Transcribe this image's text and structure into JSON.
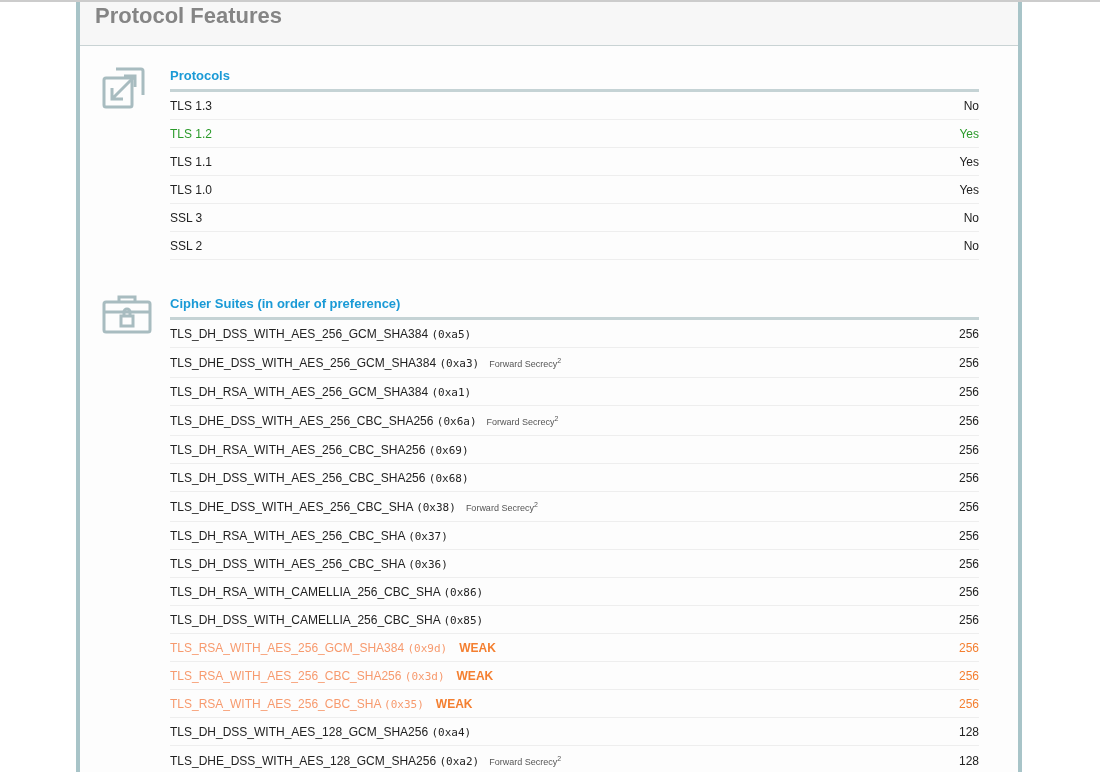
{
  "title": "Protocol Features",
  "protocols": {
    "heading": "Protocols",
    "rows": [
      {
        "name": "TLS 1.3",
        "value": "No",
        "kind": "plain"
      },
      {
        "name": "TLS 1.2",
        "value": "Yes",
        "kind": "good"
      },
      {
        "name": "TLS 1.1",
        "value": "Yes",
        "kind": "plain"
      },
      {
        "name": "TLS 1.0",
        "value": "Yes",
        "kind": "plain"
      },
      {
        "name": "SSL 3",
        "value": "No",
        "kind": "plain"
      },
      {
        "name": "SSL 2",
        "value": "No",
        "kind": "plain"
      }
    ]
  },
  "cipher_suites": {
    "heading": "Cipher Suites (in order of preference)",
    "rows": [
      {
        "name": "TLS_DH_DSS_WITH_AES_256_GCM_SHA384",
        "code": "(0xa5)",
        "bits": "256",
        "kind": "plain"
      },
      {
        "name": "TLS_DHE_DSS_WITH_AES_256_GCM_SHA384",
        "code": "(0xa3)",
        "note": "Forward Secrecy$^{2}$",
        "bits": "256",
        "kind": "plain"
      },
      {
        "name": "TLS_DH_RSA_WITH_AES_256_GCM_SHA384",
        "code": "(0xa1)",
        "bits": "256",
        "kind": "plain"
      },
      {
        "name": "TLS_DHE_DSS_WITH_AES_256_CBC_SHA256",
        "code": "(0x6a)",
        "note": "Forward Secrecy$^{2}$",
        "bits": "256",
        "kind": "plain"
      },
      {
        "name": "TLS_DH_RSA_WITH_AES_256_CBC_SHA256",
        "code": "(0x69)",
        "bits": "256",
        "kind": "plain"
      },
      {
        "name": "TLS_DH_DSS_WITH_AES_256_CBC_SHA256",
        "code": "(0x68)",
        "bits": "256",
        "kind": "plain"
      },
      {
        "name": "TLS_DHE_DSS_WITH_AES_256_CBC_SHA",
        "code": "(0x38)",
        "note": "Forward Secrecy$^{2}$",
        "bits": "256",
        "kind": "plain"
      },
      {
        "name": "TLS_DH_RSA_WITH_AES_256_CBC_SHA",
        "code": "(0x37)",
        "bits": "256",
        "kind": "plain"
      },
      {
        "name": "TLS_DH_DSS_WITH_AES_256_CBC_SHA",
        "code": "(0x36)",
        "bits": "256",
        "kind": "plain"
      },
      {
        "name": "TLS_DH_RSA_WITH_CAMELLIA_256_CBC_SHA",
        "code": "(0x86)",
        "bits": "256",
        "kind": "plain"
      },
      {
        "name": "TLS_DH_DSS_WITH_CAMELLIA_256_CBC_SHA",
        "code": "(0x85)",
        "bits": "256",
        "kind": "plain"
      },
      {
        "name": "TLS_RSA_WITH_AES_256_GCM_SHA384",
        "code": "(0x9d)",
        "flag": "WEAK",
        "bits": "256",
        "kind": "weak"
      },
      {
        "name": "TLS_RSA_WITH_AES_256_CBC_SHA256",
        "code": "(0x3d)",
        "flag": "WEAK",
        "bits": "256",
        "kind": "weak"
      },
      {
        "name": "TLS_RSA_WITH_AES_256_CBC_SHA",
        "code": "(0x35)",
        "flag": "WEAK",
        "bits": "256",
        "kind": "weak"
      },
      {
        "name": "TLS_DH_DSS_WITH_AES_128_GCM_SHA256",
        "code": "(0xa4)",
        "bits": "128",
        "kind": "plain"
      },
      {
        "name": "TLS_DHE_DSS_WITH_AES_128_GCM_SHA256",
        "code": "(0xa2)",
        "note": "Forward Secrecy$^{2}$",
        "bits": "128",
        "kind": "plain"
      }
    ]
  }
}
